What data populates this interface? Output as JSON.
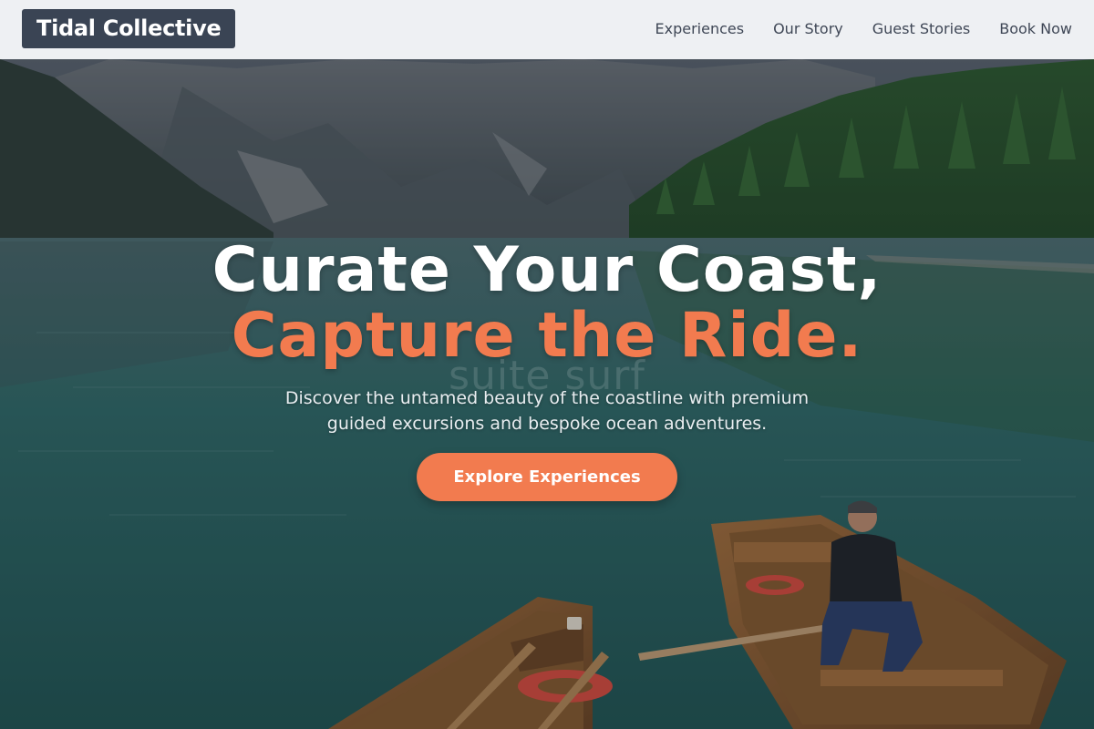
{
  "brand": {
    "name": "Tidal Collective"
  },
  "nav": {
    "items": [
      {
        "label": "Experiences"
      },
      {
        "label": "Our Story"
      },
      {
        "label": "Guest Stories"
      },
      {
        "label": "Book Now"
      }
    ]
  },
  "hero": {
    "headline_line1": "Curate Your Coast,",
    "headline_line2": "Capture the Ride.",
    "watermark": "suite surf",
    "subtitle": "Discover the untamed beauty of the coastline with premium guided excursions and bespoke ocean adventures.",
    "cta_label": "Explore Experiences"
  },
  "colors": {
    "accent": "#f27b4f",
    "header_bg": "#eef0f3",
    "logo_bg": "#3a4454",
    "nav_text": "#3f4756"
  }
}
